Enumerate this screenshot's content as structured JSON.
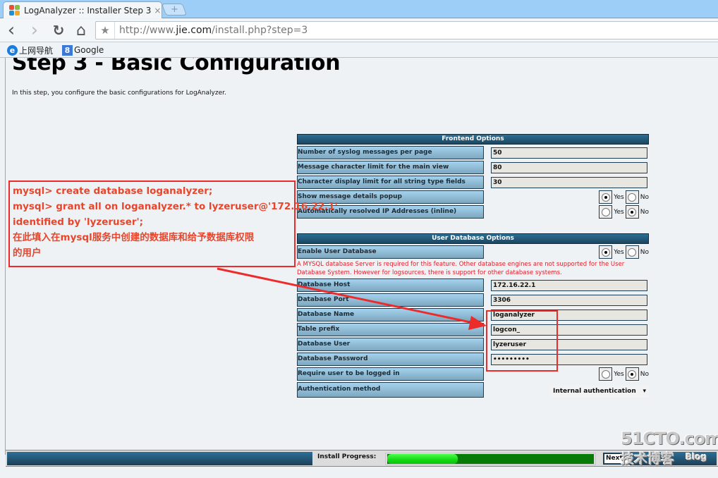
{
  "browser": {
    "tab_title": "LogAnalyzer :: Installer Step 3",
    "tab_close": "×",
    "new_tab": "+",
    "url_prefix": "http://www.",
    "url_domain": "jie.com",
    "url_path": "/install.php?step=3",
    "nav": {
      "back": "‹",
      "forward": "›",
      "reload": "↻",
      "home": "⌂",
      "star": "★"
    },
    "bookmarks": [
      {
        "label": "上网导航",
        "icon": "ie-icon",
        "glyph": "e",
        "color": "#1e7bd8"
      },
      {
        "label": "Google",
        "icon": "google-icon",
        "glyph": "8",
        "color": "#3b78d8"
      }
    ]
  },
  "page": {
    "title": "Step 3 - Basic Configuration",
    "intro": "In this step, you configure the basic configurations for LogAnalyzer."
  },
  "frontend": {
    "header": "Frontend Options",
    "rows": [
      {
        "label": "Number of syslog messages per page",
        "type": "text",
        "value": "50"
      },
      {
        "label": "Message character limit for the main view",
        "type": "text",
        "value": "80"
      },
      {
        "label": "Character display limit for all string type fields",
        "type": "text",
        "value": "30"
      },
      {
        "label": "Show message details popup",
        "type": "radio",
        "selected": "Yes",
        "yes": "Yes",
        "no": "No"
      },
      {
        "label": "Automatically resolved IP Addresses (inline)",
        "type": "radio",
        "selected": "No",
        "yes": "Yes",
        "no": "No"
      }
    ]
  },
  "userdb": {
    "header": "User Database Options",
    "enable": {
      "label": "Enable User Database",
      "selected": "Yes",
      "yes": "Yes",
      "no": "No"
    },
    "warning": "A MYSQL database Server is required for this feature. Other database engines are not supported for the User Database System. However for logsources, there is support for other database systems.",
    "rows": [
      {
        "label": "Database Host",
        "value": "172.16.22.1"
      },
      {
        "label": "Database Port",
        "value": "3306"
      },
      {
        "label": "Database Name",
        "value": "loganalyzer"
      },
      {
        "label": "Table prefix",
        "value": "logcon_"
      },
      {
        "label": "Database User",
        "value": "lyzeruser"
      },
      {
        "label": "Database Password",
        "value": "•••••••••"
      }
    ],
    "require_login": {
      "label": "Require user to be logged in",
      "selected": "No",
      "yes": "Yes",
      "no": "No"
    },
    "auth_method": {
      "label": "Authentication method",
      "value": "Internal authentication",
      "arrow": "▾"
    }
  },
  "footer": {
    "progress_label": "Install Progress:",
    "progress_fraction": 0.34,
    "next_label": "Next"
  },
  "annotation": {
    "lines": [
      "mysql> create database loganalyzer;",
      "mysql> grant all on loganalyzer.* to lyzeruser@'172.16.22.1'",
      "identified by 'lyzeruser';",
      "在此填入在mysql服务中创建的数据库和给予数据库权限",
      "的用户"
    ],
    "color": "#e8462c"
  },
  "watermark": {
    "line1": "51CTO.com",
    "line2": "技术博客",
    "line3": "Blog"
  }
}
